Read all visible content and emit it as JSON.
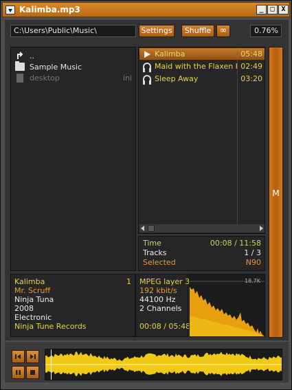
{
  "window": {
    "title": "Kalimba.mp3"
  },
  "window_buttons": {
    "minimize": "_",
    "maximize": "□",
    "close": "X"
  },
  "toolbar": {
    "path": "C:\\Users\\Public\\Music\\",
    "settings_label": "Settings",
    "shuffle_label": "Shuffle",
    "repeat_label": "∞",
    "zoom": "0.76%"
  },
  "files": [
    {
      "name": "..",
      "icon": "up-arrow-icon",
      "ext": ""
    },
    {
      "name": "Sample Music",
      "icon": "folder-icon",
      "ext": ""
    },
    {
      "name": "desktop",
      "icon": "file-icon",
      "ext": "ini"
    }
  ],
  "playlist": [
    {
      "title": "Kalimba",
      "duration": "05:48",
      "icon": "play-icon",
      "active": true
    },
    {
      "title": "Maid with the Flaxen H...",
      "duration": "02:49",
      "icon": "headphones-icon",
      "active": false
    },
    {
      "title": "Sleep Away",
      "duration": "03:20",
      "icon": "headphones-icon",
      "active": false
    }
  ],
  "stats": {
    "time_label": "Time",
    "time_value": "00:08 / 11:58",
    "tracks_label": "Tracks",
    "tracks_value": "1 / 3",
    "selected_label": "Selected",
    "selected_value": "N90"
  },
  "side_button": {
    "label": "M"
  },
  "track_info": {
    "title": "Kalimba",
    "track_number": "1",
    "artist": "Mr. Scruff",
    "album": "Ninja Tuna",
    "year": "2008",
    "genre": "Electronic",
    "label": "Ninja Tune Records"
  },
  "tech_info": {
    "format": "MPEG layer 3",
    "bitrate": "192 kbit/s",
    "samplerate": "44100 Hz",
    "channels": "2 Channels",
    "position": "00:08 / 05:48"
  },
  "spectrum": {
    "freq_label": "18.7K"
  },
  "playback": {
    "progress_fraction": 0.023
  },
  "colors": {
    "accent": "#c47a2a",
    "yellow_text": "#e8d24a",
    "orange_text": "#e89a3a",
    "green_text": "#c8d86a",
    "wave": "#f0c818"
  }
}
